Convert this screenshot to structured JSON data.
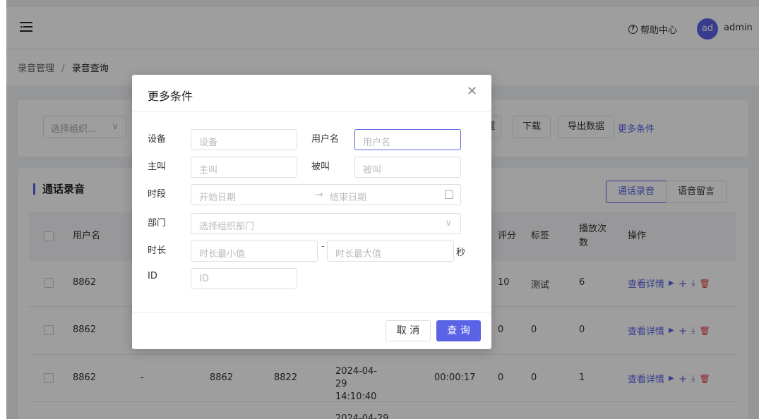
{
  "header": {
    "help_label": "帮助中心",
    "avatar_text": "ad",
    "username": "admin"
  },
  "breadcrumb": {
    "parent": "录音管理",
    "separator": "/",
    "current": "录音查询"
  },
  "filters": {
    "org_placeholder": "选择组织...",
    "button_partial": "置",
    "download": "下载",
    "export": "导出数据",
    "more": "更多条件"
  },
  "list": {
    "title": "通话录音",
    "tabs": [
      "通话录音",
      "语音留言"
    ],
    "columns": {
      "username": "用户名",
      "score": "评分",
      "tag": "标签",
      "play_count": "播放次数",
      "ops": "操作"
    },
    "rows": [
      {
        "username": "8862",
        "score": "10",
        "tag": "测试",
        "plays": "6",
        "col_b": "",
        "col_c": "",
        "col_d": "",
        "time": "",
        "duration": ""
      },
      {
        "username": "8862",
        "score": "0",
        "tag": "0",
        "plays": "0",
        "col_b": "",
        "col_c": "",
        "col_d": "",
        "time": "",
        "duration": ""
      },
      {
        "username": "8862",
        "col_b": "-",
        "col_c": "8862",
        "col_d": "8822",
        "time": "2024-04-29 14:10:40",
        "duration": "00:00:17",
        "score": "0",
        "tag": "0",
        "plays": "1"
      }
    ],
    "partial_row_time": "2024-04-29",
    "op_detail": "查看详情"
  },
  "modal": {
    "title": "更多条件",
    "fields": {
      "device_label": "设备",
      "device_placeholder": "设备",
      "username_label": "用户名",
      "username_placeholder": "用户名",
      "caller_label": "主叫",
      "caller_placeholder": "主叫",
      "callee_label": "被叫",
      "callee_placeholder": "被叫",
      "period_label": "时段",
      "start_placeholder": "开始日期",
      "range_arrow": "→",
      "end_placeholder": "结束日期",
      "dept_label": "部门",
      "dept_placeholder": "选择组织部门",
      "duration_label": "时长",
      "duration_min_placeholder": "时长最小值",
      "duration_dash": "-",
      "duration_max_placeholder": "时长最大值",
      "duration_unit": "秒",
      "id_label": "ID",
      "id_placeholder": "ID"
    },
    "cancel": "取 消",
    "submit": "查 询"
  },
  "colors": {
    "accent": "#5a62e6",
    "danger": "#e03b3b"
  }
}
